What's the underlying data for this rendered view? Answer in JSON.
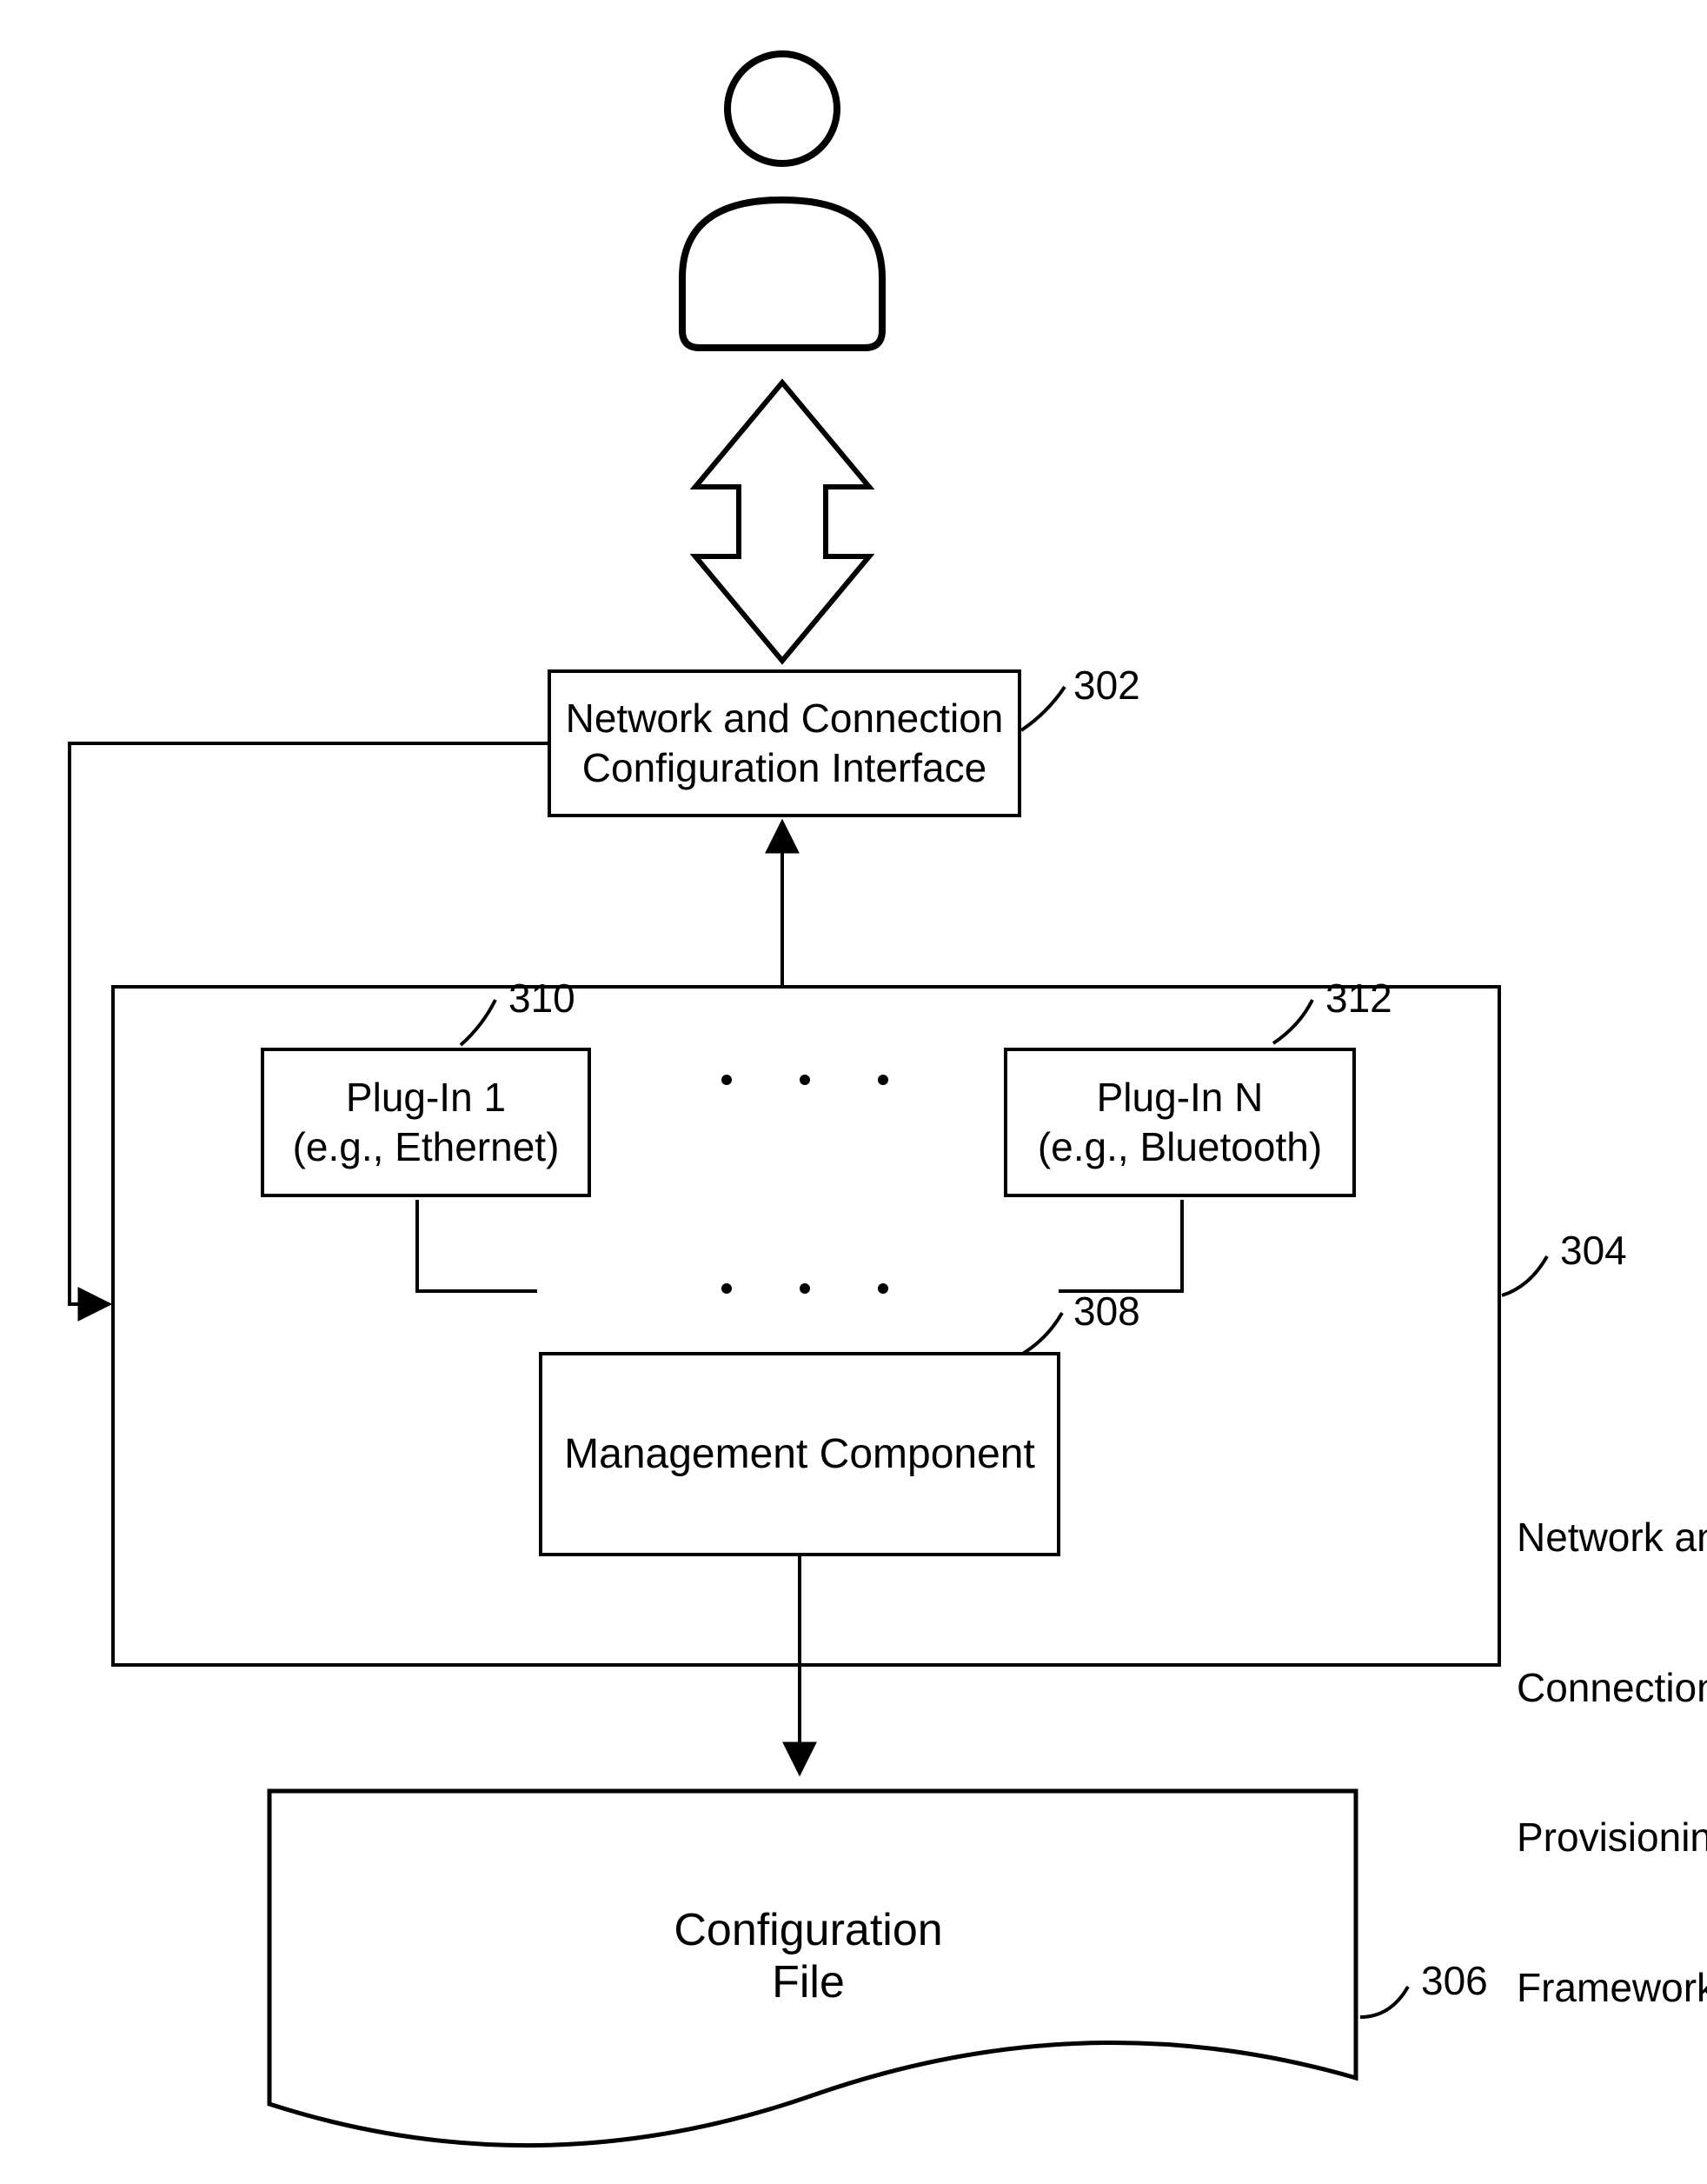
{
  "interface": {
    "line1": "Network and Connection",
    "line2": "Configuration Interface",
    "ref": "302"
  },
  "framework": {
    "caption_l1": "Network and",
    "caption_l2": "Connection",
    "caption_l3": "Provisioning",
    "caption_l4": "Framework",
    "ref": "304"
  },
  "plugin1": {
    "line1": "Plug-In 1",
    "line2": "(e.g., Ethernet)",
    "ref": "310"
  },
  "pluginN": {
    "line1": "Plug-In N",
    "line2": "(e.g., Bluetooth)",
    "ref": "312"
  },
  "mgmt": {
    "text": "Management Component",
    "ref": "308"
  },
  "config": {
    "text": "Configuration File",
    "ref": "306"
  }
}
